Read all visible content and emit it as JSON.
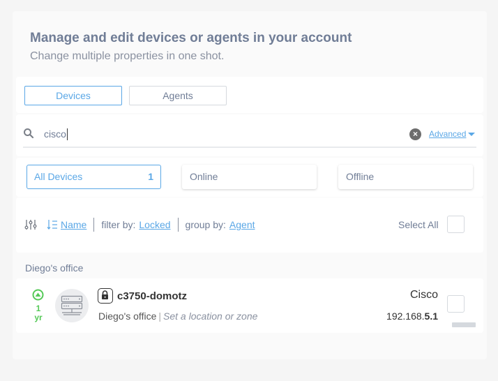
{
  "header": {
    "title": "Manage and edit devices or agents in your account",
    "subtitle": "Change multiple properties in one shot."
  },
  "tabs": [
    {
      "label": "Devices",
      "active": true
    },
    {
      "label": "Agents",
      "active": false
    }
  ],
  "search": {
    "value": "cisco",
    "clear_icon": "close-circle-icon",
    "advanced_label": "Advanced"
  },
  "filters": [
    {
      "label": "All Devices",
      "count": "1",
      "active": true
    },
    {
      "label": "Online",
      "active": false
    },
    {
      "label": "Offline",
      "active": false
    }
  ],
  "sort_bar": {
    "sort_field": "Name",
    "filter_label": "filter by:",
    "filter_value": "Locked",
    "group_label": "group by:",
    "group_value": "Agent",
    "select_all_label": "Select All"
  },
  "groups": [
    {
      "name": "Diego's office",
      "devices": [
        {
          "status": "online",
          "uptime_value": "1",
          "uptime_unit": "yr",
          "locked": true,
          "name": "c3750-domotz",
          "location": "Diego's office",
          "zone_placeholder": "Set a location or zone",
          "vendor": "Cisco",
          "ip_prefix": "192.168.",
          "ip_suffix": "5.1"
        }
      ]
    }
  ],
  "colors": {
    "accent": "#5aa7e6",
    "online": "#55c957",
    "title": "#707d96"
  }
}
